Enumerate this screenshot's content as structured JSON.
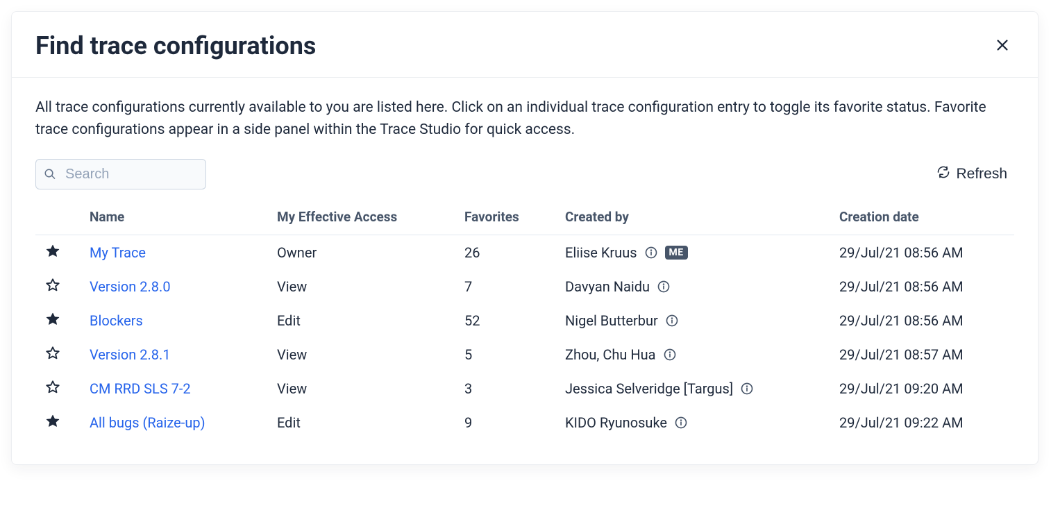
{
  "dialog": {
    "title": "Find trace configurations",
    "description": "All trace configurations currently available to you are listed here. Click on an individual trace configuration entry to toggle its favorite status. Favorite trace configurations appear in a side panel within the Trace Studio for quick access."
  },
  "search": {
    "placeholder": "Search"
  },
  "refresh": {
    "label": "Refresh"
  },
  "me_badge": "ME",
  "columns": {
    "name": "Name",
    "access": "My Effective Access",
    "favorites": "Favorites",
    "created_by": "Created by",
    "creation_date": "Creation date"
  },
  "rows": [
    {
      "favorite": true,
      "name": "My Trace",
      "access": "Owner",
      "favorites": "26",
      "created_by": "Eliise Kruus",
      "is_me": true,
      "creation_date": "29/Jul/21 08:56 AM"
    },
    {
      "favorite": false,
      "name": "Version 2.8.0",
      "access": "View",
      "favorites": "7",
      "created_by": "Davyan Naidu",
      "is_me": false,
      "creation_date": "29/Jul/21 08:56 AM"
    },
    {
      "favorite": true,
      "name": "Blockers",
      "access": "Edit",
      "favorites": "52",
      "created_by": "Nigel Butterbur",
      "is_me": false,
      "creation_date": "29/Jul/21 08:56 AM"
    },
    {
      "favorite": false,
      "name": "Version 2.8.1",
      "access": "View",
      "favorites": "5",
      "created_by": "Zhou, Chu Hua",
      "is_me": false,
      "creation_date": "29/Jul/21 08:57 AM"
    },
    {
      "favorite": false,
      "name": "CM RRD SLS 7-2",
      "access": "View",
      "favorites": "3",
      "created_by": "Jessica Selveridge [Targus]",
      "is_me": false,
      "creation_date": "29/Jul/21 09:20 AM"
    },
    {
      "favorite": true,
      "name": "All bugs (Raize-up)",
      "access": "Edit",
      "favorites": "9",
      "created_by": "KIDO Ryunosuke",
      "is_me": false,
      "creation_date": "29/Jul/21 09:22 AM"
    }
  ]
}
